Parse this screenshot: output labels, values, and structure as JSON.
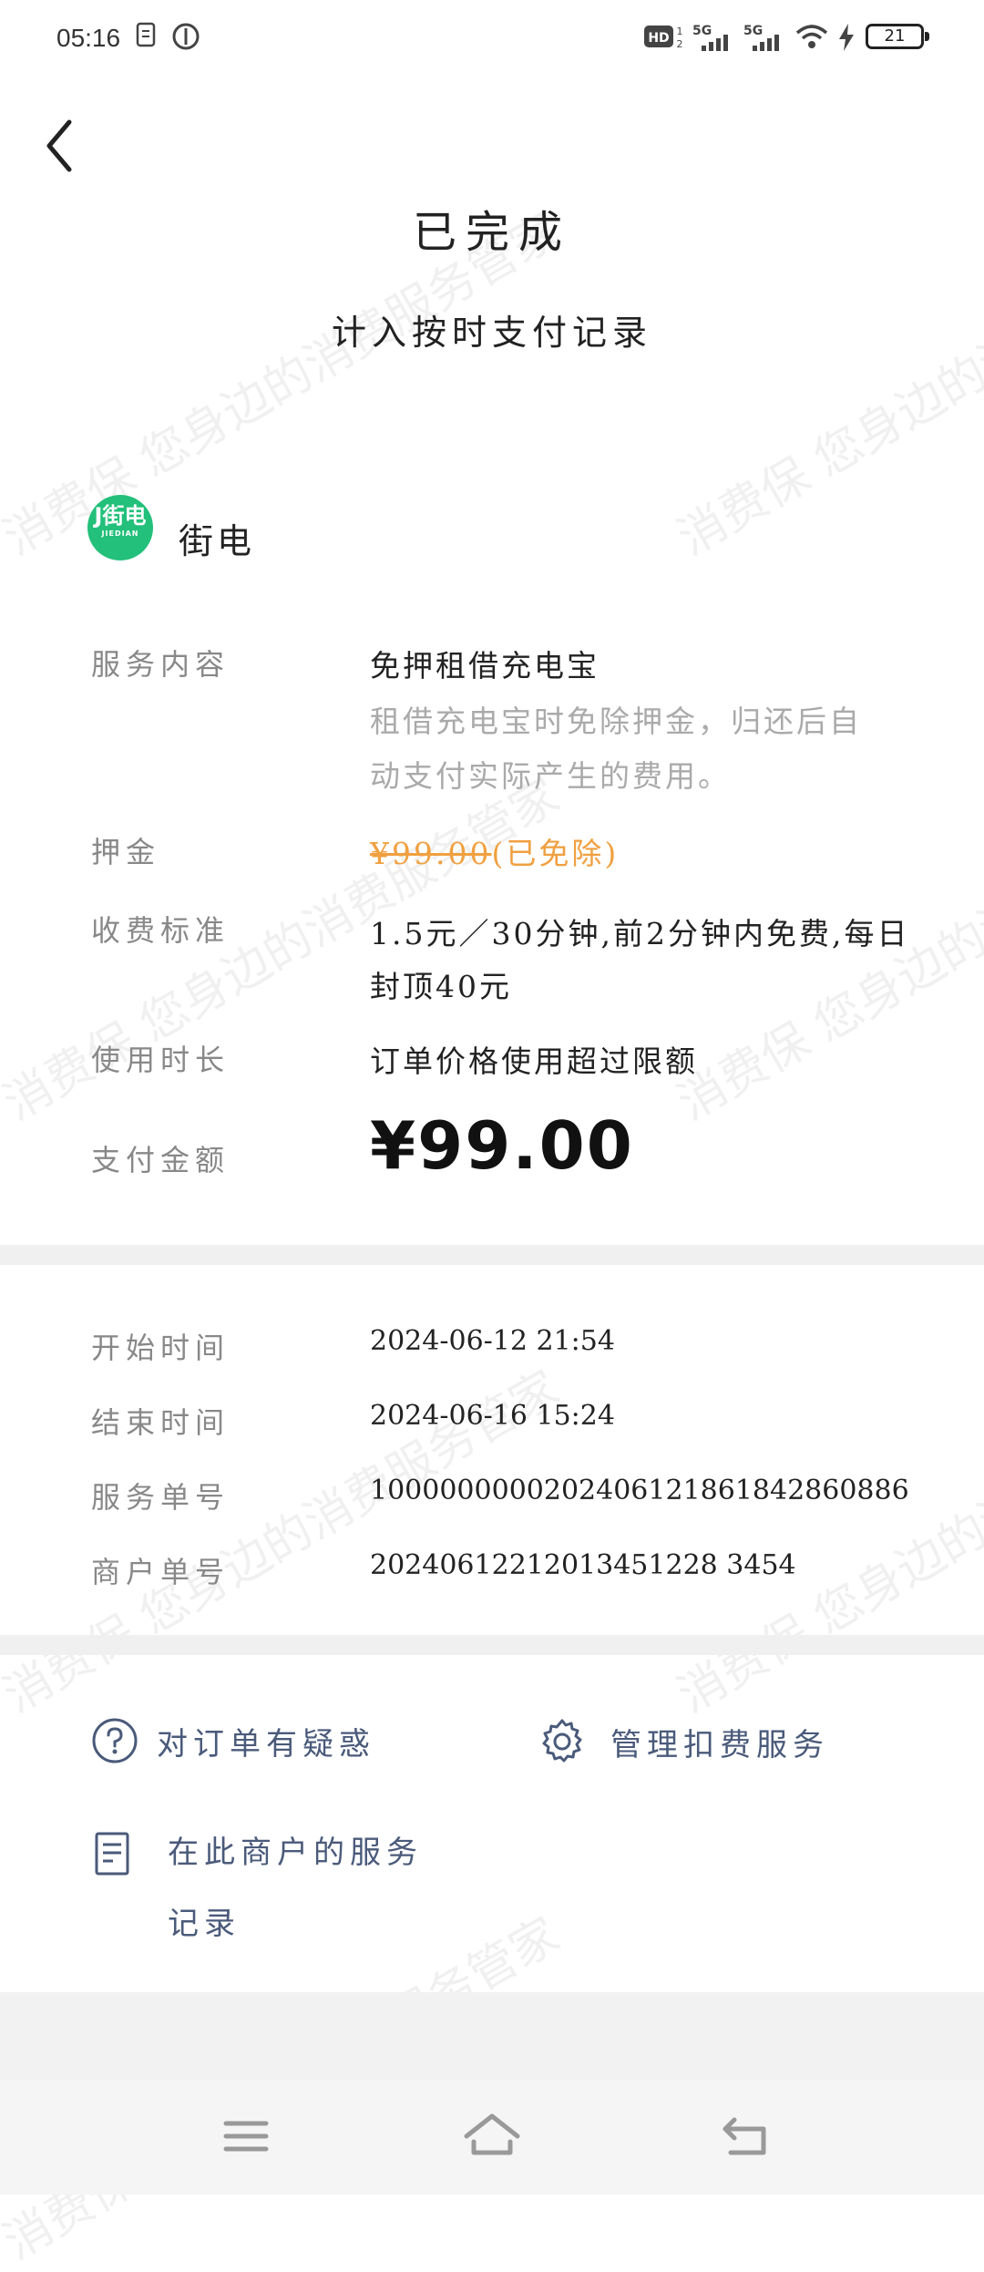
{
  "status_bar": {
    "time": "05:16",
    "battery": "21"
  },
  "header": {
    "title": "已完成",
    "subtitle": "计入按时支付记录"
  },
  "merchant": {
    "name": "街电",
    "logo_text": "J街电",
    "logo_subtext": "JIEDIAN"
  },
  "details": {
    "service_label": "服务内容",
    "service_value": "免押租借充电宝",
    "service_desc_line1": "租借充电宝时免除押金，归还后自",
    "service_desc_line2": "动支付实际产生的费用。",
    "deposit_label": "押金",
    "deposit_value": "¥99.00",
    "deposit_note": "(已免除)",
    "fee_label": "收费标准",
    "fee_line1": "1.5元／30分钟,前2分钟内免费,每日",
    "fee_line2": "封顶40元",
    "duration_label": "使用时长",
    "duration_value": "订单价格使用超过限额",
    "pay_label": "支付金额",
    "pay_value": "¥99.00"
  },
  "meta": {
    "start_label": "开始时间",
    "start_value": "2024-06-12 21:54",
    "end_label": "结束时间",
    "end_value": "2024-06-16 15:24",
    "service_no_label": "服务单号",
    "service_no_value": "1000000000202406121861842860886",
    "merchant_no_label": "商户单号",
    "merchant_no_value": "20240612212013451228 3454"
  },
  "actions": {
    "question_label": "对订单有疑惑",
    "manage_label": "管理扣费服务",
    "records_line1": "在此商户的服务",
    "records_line2": "记录"
  },
  "watermark": "消费保 您身边的消费服务管家",
  "colors": {
    "accent_orange": "#f0a040",
    "logo_green": "#22c07a",
    "action_blue": "#4a5a7a"
  }
}
